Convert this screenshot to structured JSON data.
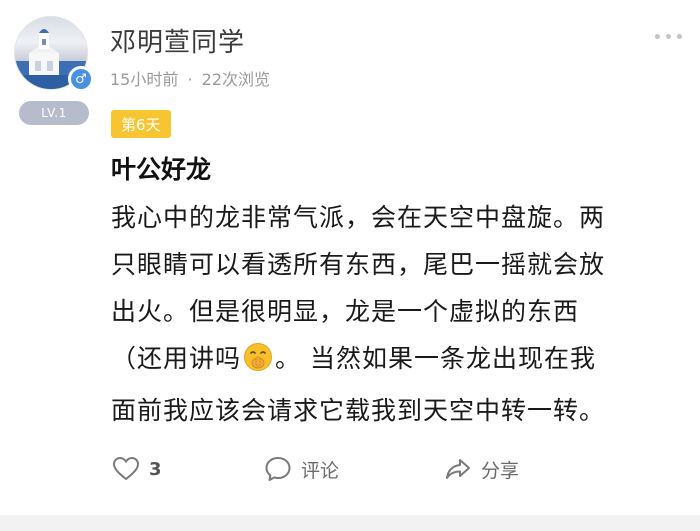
{
  "user": {
    "name": "邓明萱同学",
    "gender_symbol": "♂",
    "level": "LV.1"
  },
  "meta": {
    "time": "15小时前",
    "separator": "·",
    "views": "22次浏览"
  },
  "post": {
    "day_tag": "第6天",
    "title": "叶公好龙",
    "lines": [
      "我心中的龙非常气派，会在天空中盘旋。两",
      "只眼睛可以看透所有东西，尾巴一摇就会放",
      "出火。但是很明显，龙是一个虚拟的东西",
      "（还用讲吗",
      "。 当然如果一条龙出现在我",
      "面前我应该会请求它载我到天空中转一转。"
    ],
    "emoji_icon": "shushing-face-emoji"
  },
  "actions": {
    "like_count": "3",
    "comment_label": "评论",
    "share_label": "分享"
  },
  "colors": {
    "day_tag_bg": "#f6c531",
    "level_badge_bg": "#b6bccb",
    "gender_badge_bg": "#4a90e2"
  }
}
